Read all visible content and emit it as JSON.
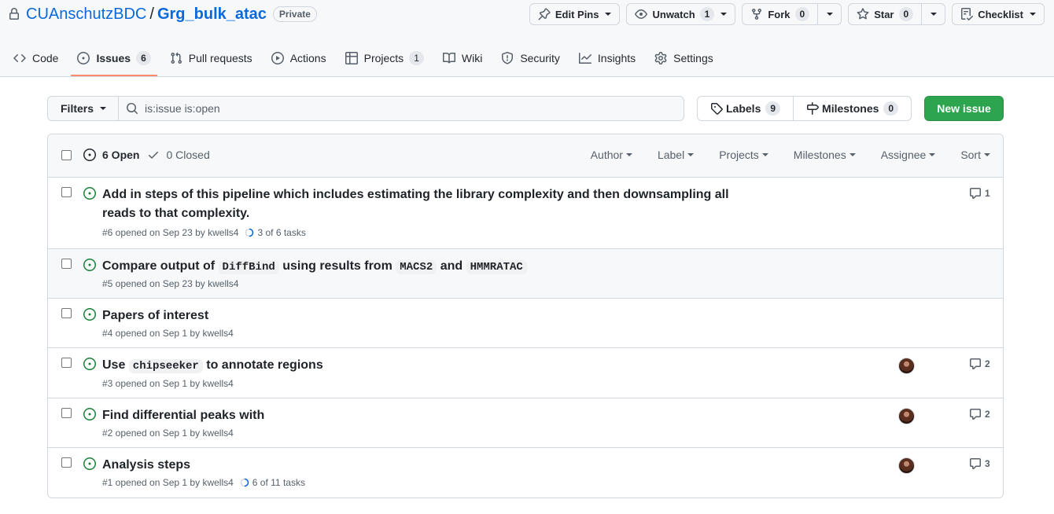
{
  "repo": {
    "owner": "CUAnschutzBDC",
    "separator": "/",
    "name": "Grg_bulk_atac",
    "visibility": "Private"
  },
  "repo_actions": {
    "edit_pins": "Edit Pins",
    "unwatch": "Unwatch",
    "unwatch_count": "1",
    "fork": "Fork",
    "fork_count": "0",
    "star": "Star",
    "star_count": "0",
    "checklist": "Checklist"
  },
  "nav": {
    "code": "Code",
    "issues": "Issues",
    "issues_count": "6",
    "pull_requests": "Pull requests",
    "actions": "Actions",
    "projects": "Projects",
    "projects_count": "1",
    "wiki": "Wiki",
    "security": "Security",
    "insights": "Insights",
    "settings": "Settings"
  },
  "filters": {
    "filters_label": "Filters",
    "search_value": "is:issue is:open",
    "labels": "Labels",
    "labels_count": "9",
    "milestones": "Milestones",
    "milestones_count": "0",
    "new_issue": "New issue"
  },
  "list_header": {
    "open": "6 Open",
    "closed": "0 Closed",
    "author": "Author",
    "label": "Label",
    "projects": "Projects",
    "milestones": "Milestones",
    "assignee": "Assignee",
    "sort": "Sort"
  },
  "issues": [
    {
      "title": "Add in steps of this pipeline which includes estimating the library complexity and then downsampling all reads to that complexity.",
      "meta": "#6 opened on Sep 23 by kwells4",
      "tasks": "3 of 6 tasks",
      "comments": "1"
    },
    {
      "title_parts": [
        "Compare output of ",
        "DiffBind",
        " using results from ",
        "MACS2",
        " and ",
        "HMMRATAC"
      ],
      "meta": "#5 opened on Sep 23 by kwells4"
    },
    {
      "title": "Papers of interest",
      "meta": "#4 opened on Sep 1 by kwells4"
    },
    {
      "title_parts": [
        "Use ",
        "chipseeker",
        " to annotate regions"
      ],
      "meta": "#3 opened on Sep 1 by kwells4",
      "comments": "2"
    },
    {
      "title": "Find differential peaks with",
      "meta": "#2 opened on Sep 1 by kwells4",
      "comments": "2"
    },
    {
      "title": "Analysis steps",
      "meta": "#1 opened on Sep 1 by kwells4",
      "tasks": "6 of 11 tasks",
      "comments": "3"
    }
  ],
  "colors": {
    "accent_link": "#0969da",
    "open_issue": "#1a7f37",
    "new_issue_button": "#2da44e",
    "selected_tab_underline": "#fd8c73"
  },
  "icons": [
    "lock-icon",
    "pin-icon",
    "eye-icon",
    "fork-icon",
    "star-icon",
    "checklist-icon",
    "code-icon",
    "issue-opened-icon",
    "pull-request-icon",
    "play-icon",
    "table-icon",
    "book-icon",
    "shield-icon",
    "graph-icon",
    "gear-icon",
    "search-icon",
    "tag-icon",
    "milestone-icon",
    "check-icon",
    "comment-icon",
    "progress-icon"
  ]
}
